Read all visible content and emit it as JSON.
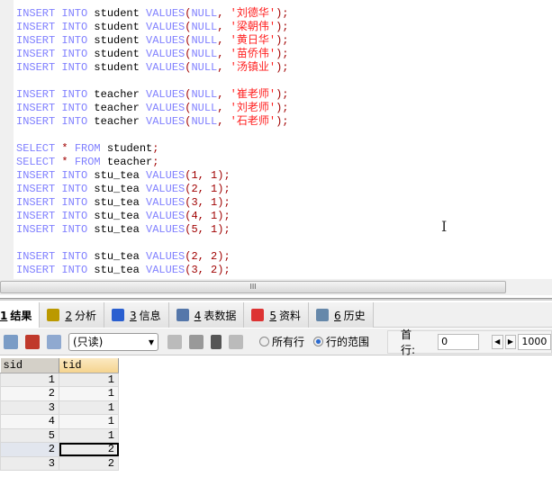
{
  "editor": {
    "lines": [
      [
        [
          "kw",
          "INSERT INTO "
        ],
        [
          "id",
          "student "
        ],
        [
          "kw",
          "VALUES"
        ],
        [
          "p",
          "("
        ],
        [
          "kw",
          "NULL"
        ],
        [
          "p",
          ", "
        ],
        [
          "str",
          "'刘德华'"
        ],
        [
          "p",
          ");"
        ]
      ],
      [
        [
          "kw",
          "INSERT INTO "
        ],
        [
          "id",
          "student "
        ],
        [
          "kw",
          "VALUES"
        ],
        [
          "p",
          "("
        ],
        [
          "kw",
          "NULL"
        ],
        [
          "p",
          ", "
        ],
        [
          "str",
          "'梁朝伟'"
        ],
        [
          "p",
          ");"
        ]
      ],
      [
        [
          "kw",
          "INSERT INTO "
        ],
        [
          "id",
          "student "
        ],
        [
          "kw",
          "VALUES"
        ],
        [
          "p",
          "("
        ],
        [
          "kw",
          "NULL"
        ],
        [
          "p",
          ", "
        ],
        [
          "str",
          "'黄日华'"
        ],
        [
          "p",
          ");"
        ]
      ],
      [
        [
          "kw",
          "INSERT INTO "
        ],
        [
          "id",
          "student "
        ],
        [
          "kw",
          "VALUES"
        ],
        [
          "p",
          "("
        ],
        [
          "kw",
          "NULL"
        ],
        [
          "p",
          ", "
        ],
        [
          "str",
          "'苗侨伟'"
        ],
        [
          "p",
          ");"
        ]
      ],
      [
        [
          "kw",
          "INSERT INTO "
        ],
        [
          "id",
          "student "
        ],
        [
          "kw",
          "VALUES"
        ],
        [
          "p",
          "("
        ],
        [
          "kw",
          "NULL"
        ],
        [
          "p",
          ", "
        ],
        [
          "str",
          "'汤镇业'"
        ],
        [
          "p",
          ");"
        ]
      ],
      [],
      [
        [
          "kw",
          "INSERT INTO "
        ],
        [
          "id",
          "teacher "
        ],
        [
          "kw",
          "VALUES"
        ],
        [
          "p",
          "("
        ],
        [
          "kw",
          "NULL"
        ],
        [
          "p",
          ", "
        ],
        [
          "str",
          "'崔老师'"
        ],
        [
          "p",
          ");"
        ]
      ],
      [
        [
          "kw",
          "INSERT INTO "
        ],
        [
          "id",
          "teacher "
        ],
        [
          "kw",
          "VALUES"
        ],
        [
          "p",
          "("
        ],
        [
          "kw",
          "NULL"
        ],
        [
          "p",
          ", "
        ],
        [
          "str",
          "'刘老师'"
        ],
        [
          "p",
          ");"
        ]
      ],
      [
        [
          "kw",
          "INSERT INTO "
        ],
        [
          "id",
          "teacher "
        ],
        [
          "kw",
          "VALUES"
        ],
        [
          "p",
          "("
        ],
        [
          "kw",
          "NULL"
        ],
        [
          "p",
          ", "
        ],
        [
          "str",
          "'石老师'"
        ],
        [
          "p",
          ");"
        ]
      ],
      [],
      [
        [
          "kw",
          "SELECT "
        ],
        [
          "op",
          "* "
        ],
        [
          "kw",
          "FROM "
        ],
        [
          "id",
          "student"
        ],
        [
          "p",
          ";"
        ]
      ],
      [
        [
          "kw",
          "SELECT "
        ],
        [
          "op",
          "* "
        ],
        [
          "kw",
          "FROM "
        ],
        [
          "id",
          "teacher"
        ],
        [
          "p",
          ";"
        ]
      ],
      [
        [
          "kw",
          "INSERT INTO "
        ],
        [
          "id",
          "stu_tea "
        ],
        [
          "kw",
          "VALUES"
        ],
        [
          "num",
          "(1, 1);"
        ]
      ],
      [
        [
          "kw",
          "INSERT INTO "
        ],
        [
          "id",
          "stu_tea "
        ],
        [
          "kw",
          "VALUES"
        ],
        [
          "num",
          "(2, 1);"
        ]
      ],
      [
        [
          "kw",
          "INSERT INTO "
        ],
        [
          "id",
          "stu_tea "
        ],
        [
          "kw",
          "VALUES"
        ],
        [
          "num",
          "(3, 1);"
        ]
      ],
      [
        [
          "kw",
          "INSERT INTO "
        ],
        [
          "id",
          "stu_tea "
        ],
        [
          "kw",
          "VALUES"
        ],
        [
          "num",
          "(4, 1);"
        ]
      ],
      [
        [
          "kw",
          "INSERT INTO "
        ],
        [
          "id",
          "stu_tea "
        ],
        [
          "kw",
          "VALUES"
        ],
        [
          "num",
          "(5, 1);"
        ]
      ],
      [],
      [
        [
          "kw",
          "INSERT INTO "
        ],
        [
          "id",
          "stu_tea "
        ],
        [
          "kw",
          "VALUES"
        ],
        [
          "num",
          "(2, 2);"
        ]
      ],
      [
        [
          "kw",
          "INSERT INTO "
        ],
        [
          "id",
          "stu_tea "
        ],
        [
          "kw",
          "VALUES"
        ],
        [
          "num",
          "(3, 2);"
        ]
      ]
    ],
    "scroll_grip": "III"
  },
  "tabs": [
    {
      "num": "1",
      "label": "结果",
      "icon": "results-grid-icon",
      "color": "#4a7"
    },
    {
      "num": "2",
      "label": "分析",
      "icon": "profiler-icon",
      "color": "#b90"
    },
    {
      "num": "3",
      "label": "信息",
      "icon": "info-icon",
      "color": "#2a5fd0"
    },
    {
      "num": "4",
      "label": "表数据",
      "icon": "table-data-icon",
      "color": "#5577aa"
    },
    {
      "num": "5",
      "label": "资料",
      "icon": "info-chart-icon",
      "color": "#d33"
    },
    {
      "num": "6",
      "label": "历史",
      "icon": "calendar-icon",
      "color": "#6688aa"
    }
  ],
  "toolbar": {
    "mode_select": "(只读)",
    "radio_all_rows": "所有行",
    "radio_row_range": "行的范围",
    "first_row_label": "首行:",
    "first_row_value": "0",
    "row_count_value": "1000"
  },
  "grid": {
    "columns": [
      "sid",
      "tid"
    ],
    "rows": [
      [
        "1",
        "1"
      ],
      [
        "2",
        "1"
      ],
      [
        "3",
        "1"
      ],
      [
        "4",
        "1"
      ],
      [
        "5",
        "1"
      ],
      [
        "2",
        "2"
      ],
      [
        "3",
        "2"
      ]
    ]
  }
}
